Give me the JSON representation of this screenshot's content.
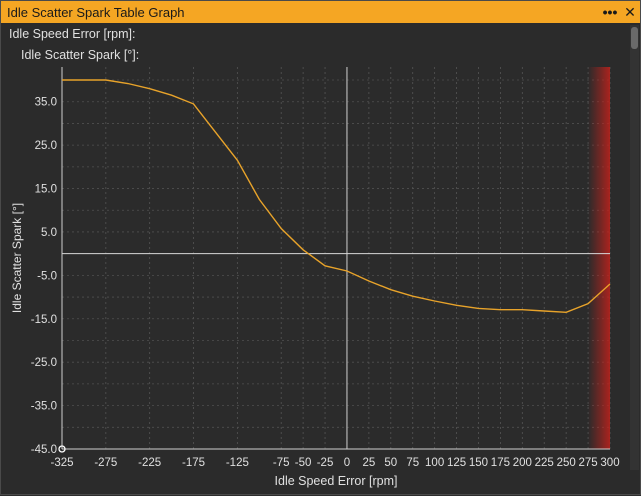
{
  "window": {
    "title": "Idle Scatter Spark Table Graph",
    "menu_icon": "ellipsis-icon",
    "close_icon": "close-icon"
  },
  "readouts": {
    "x_readout_label": "Idle Speed Error [rpm]:",
    "y_readout_label": "Idle Scatter Spark [°]:"
  },
  "colors": {
    "title_bar": "#f5a623",
    "line": "#e8a32a",
    "background": "#2b2b2b",
    "grid": "#555555",
    "zero_line": "#d8d8d8",
    "limit_band": "#c0221c"
  },
  "chart_data": {
    "type": "line",
    "title": "",
    "xlabel": "Idle Speed Error [rpm]",
    "ylabel": "Idle Scatter Spark [°]",
    "xlim": [
      -325,
      300
    ],
    "ylim": [
      -45,
      43
    ],
    "x_tick_labels": [
      "-325",
      "-275",
      "-225",
      "-175",
      "-125",
      "-75",
      "-50",
      "-25",
      "0",
      "25",
      "50",
      "75",
      "100",
      "125",
      "150",
      "175",
      "200",
      "225",
      "250",
      "275",
      "300"
    ],
    "x_tick_values": [
      -325,
      -275,
      -225,
      -175,
      -125,
      -75,
      -50,
      -25,
      0,
      25,
      50,
      75,
      100,
      125,
      150,
      175,
      200,
      225,
      250,
      275,
      300
    ],
    "y_tick_labels": [
      "-45.0",
      "-35.0",
      "-25.0",
      "-15.0",
      "-5.0",
      "5.0",
      "15.0",
      "25.0",
      "35.0"
    ],
    "y_tick_values": [
      -45,
      -35,
      -25,
      -15,
      -5,
      5,
      15,
      25,
      35
    ],
    "grid": true,
    "series": [
      {
        "x": [
          -325,
          -300,
          -275,
          -250,
          -225,
          -200,
          -175,
          -150,
          -125,
          -100,
          -75,
          -50,
          -25,
          0,
          25,
          50,
          75,
          100,
          125,
          150,
          175,
          200,
          225,
          250,
          275,
          300
        ],
        "y": [
          40,
          40,
          40,
          39.2,
          38,
          36.5,
          34.5,
          28,
          21.5,
          12.5,
          5.8,
          0.9,
          -2.8,
          -4,
          -6.3,
          -8.3,
          -9.8,
          -10.9,
          -11.9,
          -12.6,
          -12.9,
          -12.9,
          -13.2,
          -13.5,
          -11.5,
          -7
        ]
      }
    ],
    "limit_band": {
      "from": 275,
      "to": 300
    }
  }
}
